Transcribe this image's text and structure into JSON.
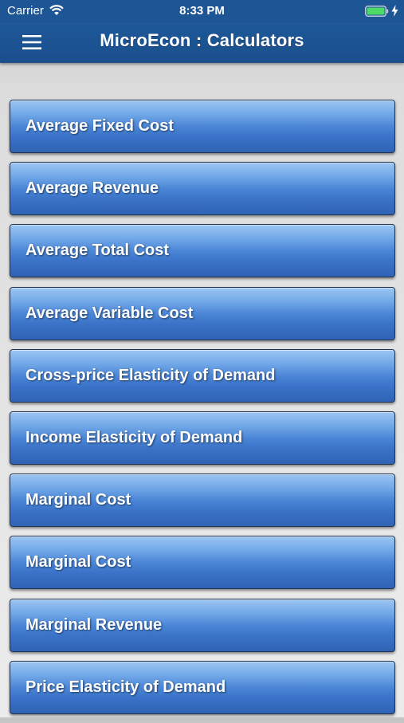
{
  "status_bar": {
    "carrier": "Carrier",
    "time": "8:33 PM",
    "icons": [
      "wifi-icon",
      "battery-icon",
      "charging-icon"
    ]
  },
  "nav": {
    "title": "MicroEcon : Calculators",
    "menu_icon": "hamburger-menu-icon"
  },
  "calculators": [
    {
      "label": "Average Fixed Cost"
    },
    {
      "label": "Average Revenue"
    },
    {
      "label": "Average Total Cost"
    },
    {
      "label": "Average Variable Cost"
    },
    {
      "label": "Cross-price Elasticity of Demand"
    },
    {
      "label": "Income Elasticity of Demand"
    },
    {
      "label": "Marginal Cost"
    },
    {
      "label": "Marginal Cost"
    },
    {
      "label": "Marginal Revenue"
    },
    {
      "label": "Price Elasticity of Demand"
    }
  ],
  "colors": {
    "nav_background": "#1d5595",
    "button_top": "#9cc6f3",
    "button_bottom": "#2f63b4",
    "battery": "#4cd964"
  }
}
